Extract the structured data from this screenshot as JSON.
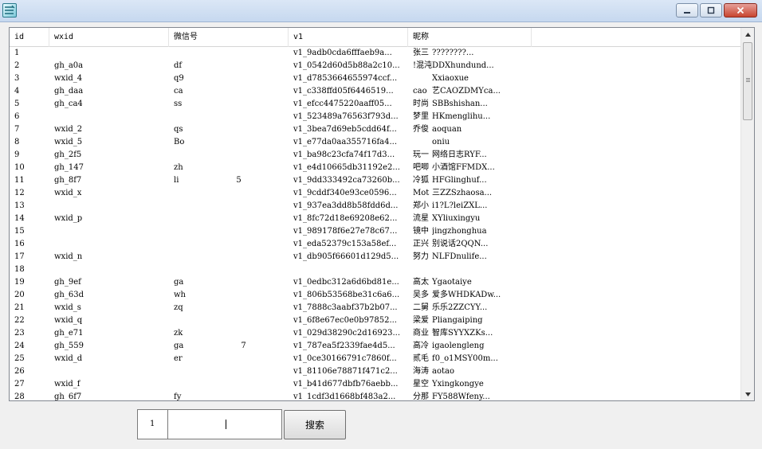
{
  "window": {
    "icon": "app-icon",
    "buttons": [
      "minimize-icon",
      "maximize-icon",
      "close-icon"
    ]
  },
  "table": {
    "columns": [
      "id",
      "wxid",
      "微信号",
      "v1",
      "昵称"
    ],
    "rows": [
      {
        "id": "1",
        "wxid": "",
        "wx": "",
        "v1": "v1_9adb0cda6fffaeb9a...",
        "nick_a": "张三",
        "nick_b": "????????..."
      },
      {
        "id": "2",
        "wxid": "gh_a0a",
        "wx": "df",
        "v1": "v1_0542d60d5b88a2c10...",
        "nick_a": "!混沌",
        "nick_b": "DDXhundund..."
      },
      {
        "id": "3",
        "wxid": "wxid_4",
        "wx": "q9",
        "v1": "v1_d7853664655974ccf...",
        "nick_a": "",
        "nick_b": "Xxiaoxue"
      },
      {
        "id": "4",
        "wxid": "gh_daa",
        "wx": "ca",
        "v1": "v1_c338ffd05f6446519...",
        "nick_a": "cao",
        "nick_b": "艺CAOZDMYca..."
      },
      {
        "id": "5",
        "wxid": "gh_ca4",
        "wx": "ss",
        "v1": "v1_efcc4475220aaff05...",
        "nick_a": "时尚",
        "nick_b": "SBBshishan..."
      },
      {
        "id": "6",
        "wxid": "",
        "wx": "",
        "v1": "v1_523489a76563f793d...",
        "nick_a": "梦里",
        "nick_b": "HKmenglihu..."
      },
      {
        "id": "7",
        "wxid": "wxid_2",
        "wx": "qs",
        "v1": "v1_3bea7d69eb5cdd64f...",
        "nick_a": "乔俊",
        "nick_b": "aoquan"
      },
      {
        "id": "8",
        "wxid": "wxid_5",
        "wx": "Bo",
        "v1": "v1_e77da0aa355716fa4...",
        "nick_a": "",
        "nick_b": "oniu"
      },
      {
        "id": "9",
        "wxid": "gh_2f5",
        "wx": "",
        "v1": "v1_ba98c23cfa74f17d3...",
        "nick_a": "玩一",
        "nick_b": "网络日志RYF..."
      },
      {
        "id": "10",
        "wxid": "gh_147",
        "wx": "zh",
        "v1": "v1_e4d10665db31192e2...",
        "nick_a": "吧唧",
        "nick_b": "小酒馆FFMDX..."
      },
      {
        "id": "11",
        "wxid": "gh_8f7",
        "wx": "li",
        "wx_extra": "5",
        "v1": "v1_9dd333492ca73260b...",
        "nick_a": "冷狐",
        "nick_b": "HFGlinghuf..."
      },
      {
        "id": "12",
        "wxid": "wxid_x",
        "wx": "",
        "v1": "v1_9cddf340e93ce0596...",
        "nick_a": "Mot",
        "nick_b": "三ZZSzhaosa..."
      },
      {
        "id": "13",
        "wxid": "",
        "wx": "",
        "v1": "v1_937ea3dd8b58fdd6d...",
        "nick_a": "郑小",
        "nick_b": "i1?L?leiZXL..."
      },
      {
        "id": "14",
        "wxid": "wxid_p",
        "wx": "",
        "v1": "v1_8fc72d18e69208e62...",
        "nick_a": "流星",
        "nick_b": "XYliuxingyu"
      },
      {
        "id": "15",
        "wxid": "",
        "wx": "",
        "v1": "v1_989178f6e27e78c67...",
        "nick_a": "镜中",
        "nick_b": "jingzhonghua"
      },
      {
        "id": "16",
        "wxid": "",
        "wx": "",
        "v1": "v1_eda52379c153a58ef...",
        "nick_a": "正兴",
        "nick_b": "别说话2QQN..."
      },
      {
        "id": "17",
        "wxid": "wxid_n",
        "wx": "",
        "v1": "v1_db905f66601d129d5...",
        "nick_a": "努力",
        "nick_b": "NLFDnulife..."
      },
      {
        "id": "18",
        "wxid": "",
        "wx": "",
        "v1": "",
        "nick_a": "",
        "nick_b": ""
      },
      {
        "id": "19",
        "wxid": "gh_9ef",
        "wx": "ga",
        "v1": "v1_0edbc312a6d6bd81e...",
        "nick_a": "高太",
        "nick_b": "Ygaotaiye"
      },
      {
        "id": "20",
        "wxid": "gh_63d",
        "wx": "wh",
        "v1": "v1_806b53568be31c6a6...",
        "nick_a": "吴多",
        "nick_b": "爱多WHDKADw..."
      },
      {
        "id": "21",
        "wxid": "wxid_s",
        "wx": "zq",
        "v1": "v1_7888c3aabf37b2b07...",
        "nick_a": "二舅",
        "nick_b": "乐乐2ZZCYY..."
      },
      {
        "id": "22",
        "wxid": "wxid_q",
        "wx": "",
        "v1": "v1_6f8e67ec0e0b97852...",
        "nick_a": "梁爱",
        "nick_b": "Pliangaiping"
      },
      {
        "id": "23",
        "wxid": "gh_e71",
        "wx": "zk",
        "v1": "v1_029d38290c2d16923...",
        "nick_a": "商业",
        "nick_b": "智库SYYXZKs..."
      },
      {
        "id": "24",
        "wxid": "gh_559",
        "wx": "ga",
        "wx_extra": "7",
        "v1": "v1_787ea5f2339fae4d5...",
        "nick_a": "高冷",
        "nick_b": "igaolengleng"
      },
      {
        "id": "25",
        "wxid": "wxid_d",
        "wx": "er",
        "v1": "v1_0ce30166791c7860f...",
        "nick_a": "贰毛",
        "nick_b": "f0_o1MSY00m..."
      },
      {
        "id": "26",
        "wxid": "",
        "wx": "",
        "v1": "v1_81106e78871f471c2...",
        "nick_a": "海涛",
        "nick_b": "aotao"
      },
      {
        "id": "27",
        "wxid": "wxid_f",
        "wx": "",
        "v1": "v1_b41d677dbfb76aebb...",
        "nick_a": "星空",
        "nick_b": "Yxingkongye"
      },
      {
        "id": "28",
        "wxid": "gh_6f7",
        "wx": "fy",
        "v1": "v1_1cdf3d1668bf483a2...",
        "nick_a": "分那",
        "nick_b": "FY588Wfeny..."
      }
    ]
  },
  "footer": {
    "page_value": "1",
    "search_value": "",
    "search_button": "搜索"
  }
}
